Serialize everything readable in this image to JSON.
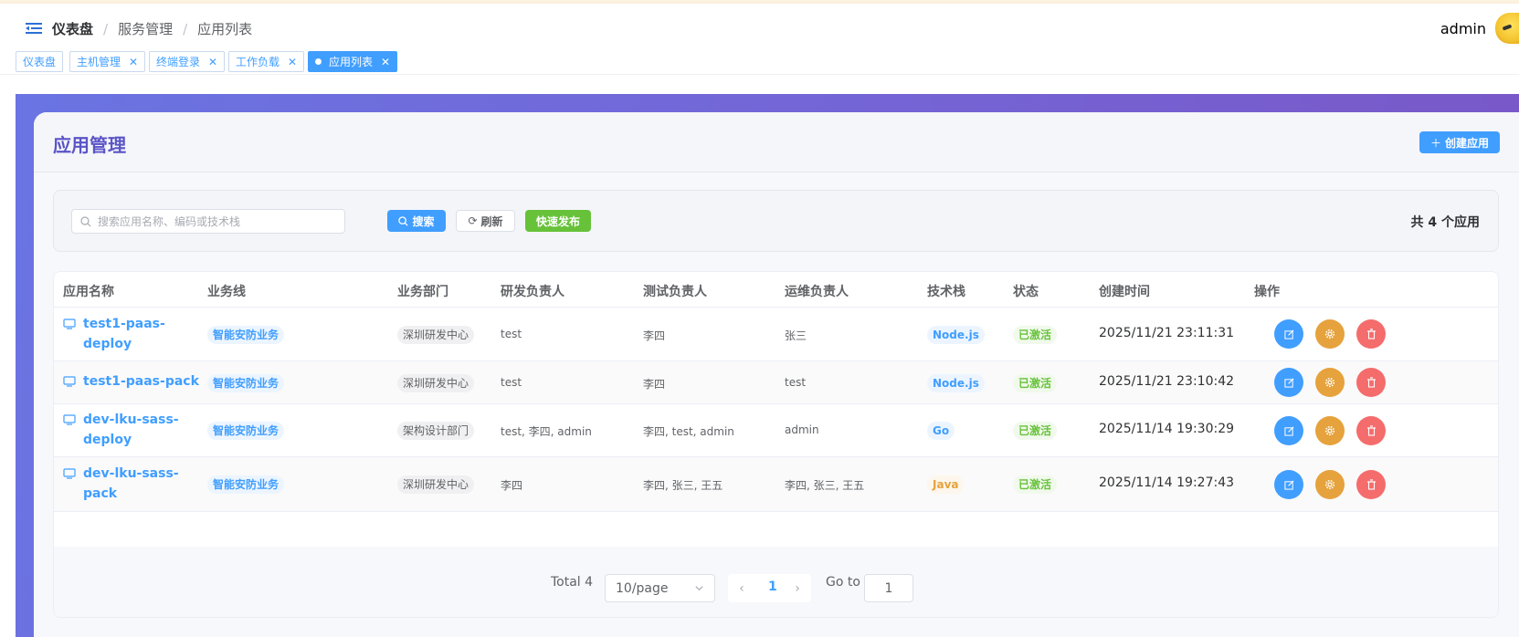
{
  "breadcrumb": [
    "仪表盘",
    "服务管理",
    "应用列表"
  ],
  "user": {
    "name": "admin"
  },
  "tags": [
    {
      "label": "仪表盘",
      "closable": false,
      "active": false
    },
    {
      "label": "主机管理",
      "closable": true,
      "active": false
    },
    {
      "label": "终端登录",
      "closable": true,
      "active": false
    },
    {
      "label": "工作负载",
      "closable": true,
      "active": false
    },
    {
      "label": "应用列表",
      "closable": true,
      "active": true
    }
  ],
  "card": {
    "title": "应用管理",
    "create_label": "创建应用"
  },
  "search": {
    "placeholder": "搜索应用名称、编码或技术栈",
    "value": "",
    "search_label": "搜索",
    "refresh_label": "刷新",
    "publish_label": "快速发布",
    "total_text": "共 4 个应用"
  },
  "table": {
    "headers": [
      "应用名称",
      "业务线",
      "业务部门",
      "研发负责人",
      "测试负责人",
      "运维负责人",
      "技术栈",
      "状态",
      "创建时间",
      "操作"
    ],
    "rows": [
      {
        "name_line1": "test1-paas-",
        "name_line2": "deploy",
        "business": "智能安防业务",
        "dept": "深圳研发中心",
        "dev": "test",
        "tester": "李四",
        "ops": "张三",
        "stack": "Node.js",
        "stack_color": "blue",
        "status": "已激活",
        "created": "2025/11/21 23:11:31"
      },
      {
        "name_line1": "test1-paas-pack",
        "name_line2": "",
        "business": "智能安防业务",
        "dept": "深圳研发中心",
        "dev": "test",
        "tester": "李四",
        "ops": "test",
        "stack": "Node.js",
        "stack_color": "blue",
        "status": "已激活",
        "created": "2025/11/21 23:10:42"
      },
      {
        "name_line1": "dev-lku-sass-",
        "name_line2": "deploy",
        "business": "智能安防业务",
        "dept": "架构设计部门",
        "dev": "test, 李四, admin",
        "tester": "李四, test, admin",
        "ops": "admin",
        "stack": "Go",
        "stack_color": "blue",
        "status": "已激活",
        "created": "2025/11/14 19:30:29"
      },
      {
        "name_line1": "dev-lku-sass-",
        "name_line2": "pack",
        "business": "智能安防业务",
        "dept": "深圳研发中心",
        "dev": "李四",
        "tester": "李四, 张三, 王五",
        "ops": "李四, 张三, 王五",
        "stack": "Java",
        "stack_color": "orange",
        "status": "已激活",
        "created": "2025/11/14 19:27:43"
      }
    ]
  },
  "pagination": {
    "total_text": "Total 4",
    "page_size": "10/page",
    "current_page": "1",
    "goto_label": "Go to",
    "goto_value": "1"
  },
  "colors": {
    "primary": "#409eff",
    "success": "#67c23a",
    "warning": "#e6a23c",
    "danger": "#f56c6c",
    "title": "#5a54c7"
  }
}
